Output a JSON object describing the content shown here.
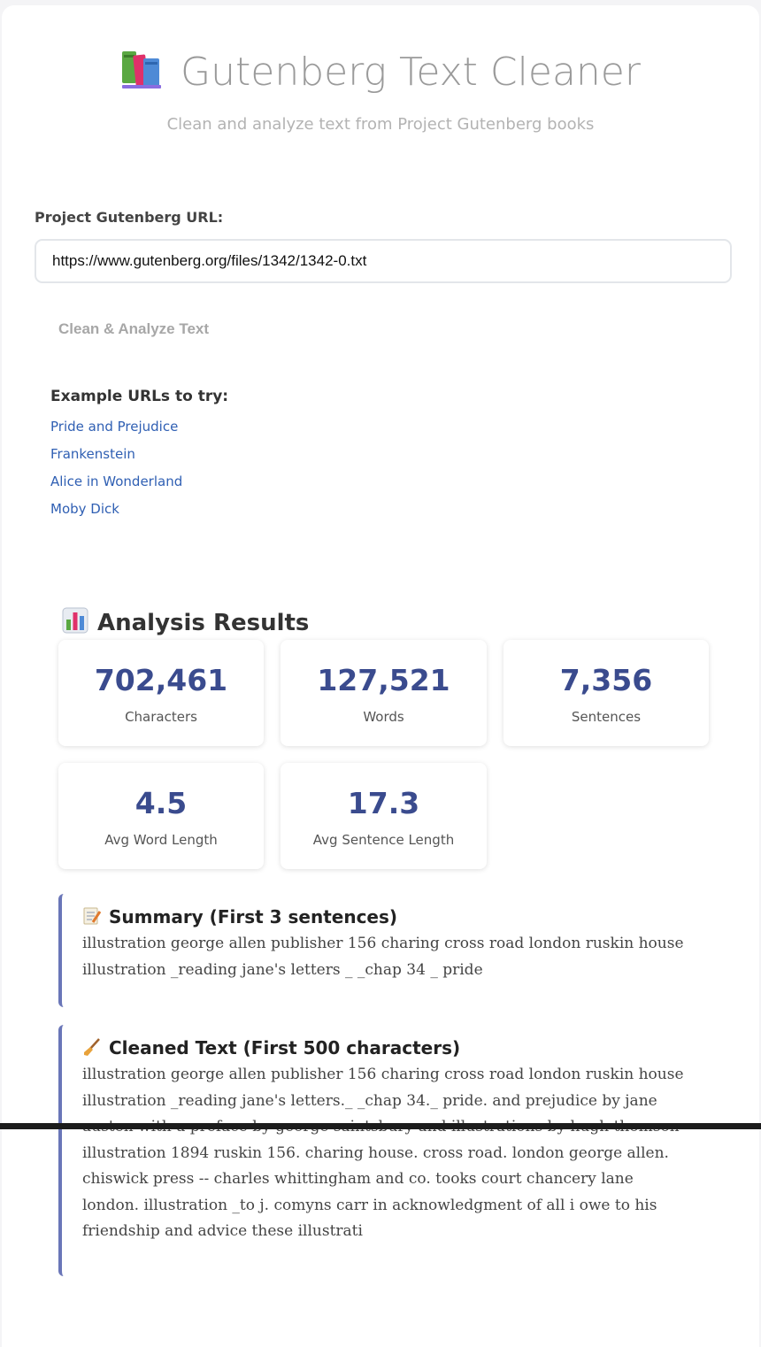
{
  "app": {
    "title": "Gutenberg Text Cleaner",
    "subtitle": "Clean and analyze text from Project Gutenberg books",
    "title_icon": "books-icon"
  },
  "form": {
    "url_label": "Project Gutenberg URL:",
    "url_value": "https://www.gutenberg.org/files/1342/1342-0.txt",
    "submit_label": "Clean & Analyze Text"
  },
  "examples": {
    "title": "Example URLs to try:",
    "links": [
      "Pride and Prejudice",
      "Frankenstein",
      "Alice in Wonderland",
      "Moby Dick"
    ]
  },
  "results": {
    "heading": "Analysis Results",
    "heading_icon": "bar-chart-icon",
    "stats": [
      {
        "value": "702,461",
        "label": "Characters"
      },
      {
        "value": "127,521",
        "label": "Words"
      },
      {
        "value": "7,356",
        "label": "Sentences"
      },
      {
        "value": "4.5",
        "label": "Avg Word Length"
      },
      {
        "value": "17.3",
        "label": "Avg Sentence Length"
      }
    ]
  },
  "summary": {
    "title": "Summary (First 3 sentences)",
    "icon": "memo-icon",
    "text": "illustration george allen publisher 156 charing cross road london ruskin house illustration _reading jane's letters _ _chap 34 _ pride"
  },
  "cleaned": {
    "title": "Cleaned Text (First 500 characters)",
    "icon": "broom-icon",
    "text": "illustration george allen publisher 156 charing cross road london ruskin house illustration _reading jane's letters._ _chap 34._ pride. and prejudice by jane austen with a preface by george saintsbury and illustrations by hugh thomson illustration 1894 ruskin 156. charing house. cross road. london george allen. chiswick press -- charles whittingham and co. tooks court chancery lane london. illustration _to j. comyns carr in acknowledgment of all i owe to his friendship and advice these illustrati"
  },
  "colors": {
    "accent": "#6a76b8",
    "stat_value": "#3a4b8e",
    "link": "#2f5fb3"
  }
}
